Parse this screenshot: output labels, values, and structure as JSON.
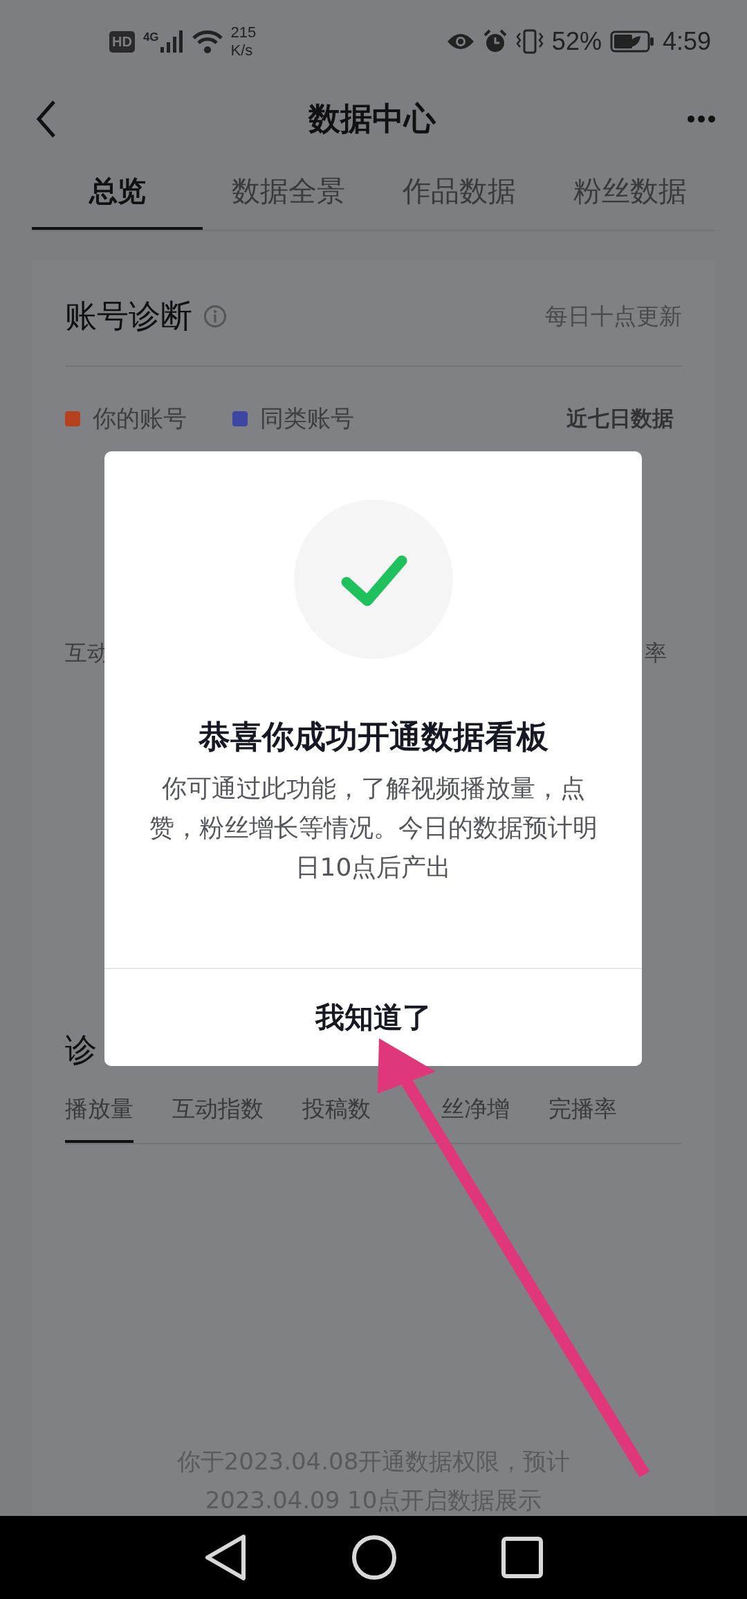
{
  "status_bar": {
    "hd_label": "HD",
    "network": "4G",
    "speed": "215",
    "speed_unit": "K/s",
    "battery": "52%",
    "time": "4:59"
  },
  "header": {
    "title": "数据中心"
  },
  "tabs": [
    {
      "label": "总览",
      "selected": true
    },
    {
      "label": "数据全景",
      "selected": false
    },
    {
      "label": "作品数据",
      "selected": false
    },
    {
      "label": "粉丝数据",
      "selected": false
    }
  ],
  "diagnosis": {
    "title": "账号诊断",
    "update_note": "每日十点更新",
    "range": "近七日数据",
    "legend": [
      {
        "label": "你的账号",
        "color": "#b5411e"
      },
      {
        "label": "同类账号",
        "color": "#3d47a3"
      }
    ],
    "axis_labels": [
      "互动",
      "率"
    ]
  },
  "details": {
    "title": "诊",
    "tabs": [
      {
        "label": "播放量",
        "selected": true
      },
      {
        "label": "互动指数",
        "selected": false
      },
      {
        "label": "投稿数",
        "selected": false
      },
      {
        "label": "丝净增",
        "selected": false
      },
      {
        "label": "完播率",
        "selected": false
      }
    ],
    "notice": [
      "你于2023.04.08开通数据权限，预计",
      "2023.04.09 10点开启数据展示"
    ]
  },
  "dialog": {
    "title": "恭喜你成功开通数据看板",
    "message": "你可通过此功能，了解视频播放量，点赞，粉丝增长等情况。今日的数据预计明日10点后产出",
    "button": "我知道了"
  }
}
